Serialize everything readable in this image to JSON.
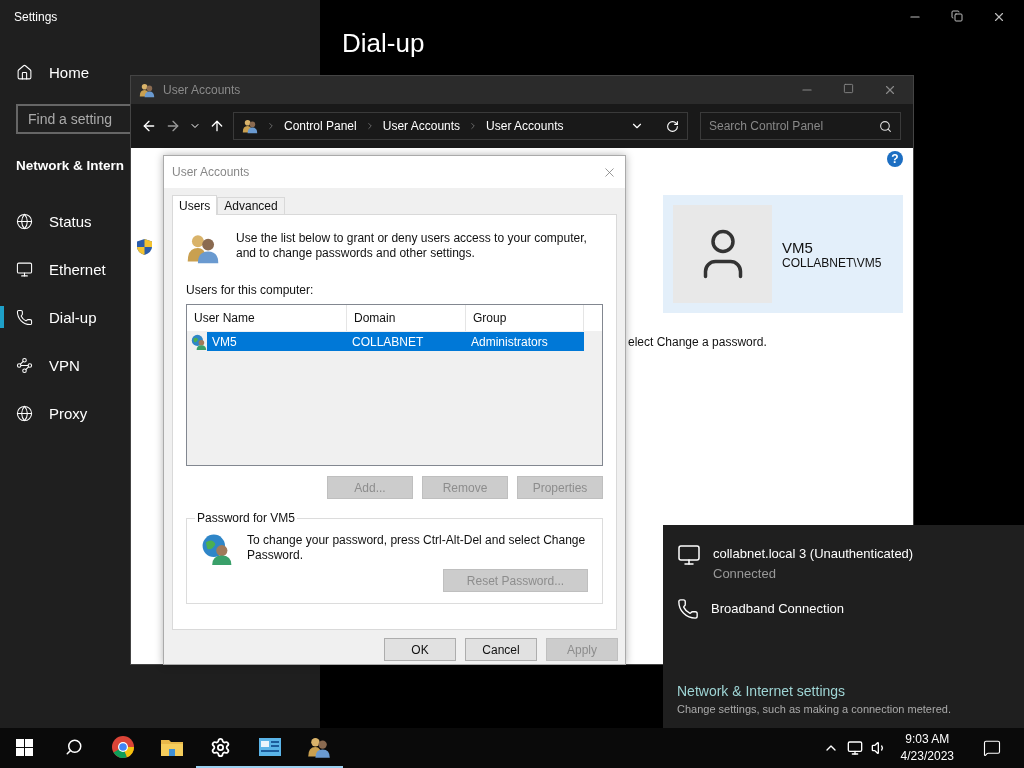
{
  "settings": {
    "title": "Settings",
    "page_title": "Dial-up",
    "home": "Home",
    "search": {
      "placeholder": "Find a setting"
    },
    "section": "Network & Intern",
    "nav": [
      {
        "label": "Status",
        "kind": "status",
        "selected": false
      },
      {
        "label": "Ethernet",
        "kind": "ethernet",
        "selected": false
      },
      {
        "label": "Dial-up",
        "kind": "dialup",
        "selected": true
      },
      {
        "label": "VPN",
        "kind": "vpn",
        "selected": false
      },
      {
        "label": "Proxy",
        "kind": "proxy",
        "selected": false
      }
    ]
  },
  "control_panel": {
    "title": "User Accounts",
    "help": "?",
    "breadcrumb": [
      "Control Panel",
      "User Accounts",
      "User Accounts"
    ],
    "search": {
      "placeholder": "Search Control Panel"
    },
    "user": {
      "name": "VM5",
      "account": "COLLABNET\\VM5"
    },
    "instruction": "elect Change a password."
  },
  "dialog": {
    "title": "User Accounts",
    "tabs": [
      {
        "label": "Users",
        "selected": true
      },
      {
        "label": "Advanced",
        "selected": false
      }
    ],
    "intro": "Use the list below to grant or deny users access to your computer, and to change passwords and other settings.",
    "list_label": "Users for this computer:",
    "columns": [
      "User Name",
      "Domain",
      "Group"
    ],
    "rows": [
      {
        "cells": [
          "VM5",
          "COLLABNET",
          "Administrators"
        ],
        "selected": true
      }
    ],
    "list_buttons": [
      {
        "label": "Add...",
        "disabled": true
      },
      {
        "label": "Remove",
        "disabled": true
      },
      {
        "label": "Properties",
        "disabled": true
      }
    ],
    "password_group": {
      "title": "Password for VM5",
      "text": "To change your password, press Ctrl-Alt-Del and select Change Password.",
      "button": {
        "label": "Reset Password...",
        "disabled": true
      }
    },
    "buttons": [
      {
        "label": "OK",
        "disabled": false
      },
      {
        "label": "Cancel",
        "disabled": false
      },
      {
        "label": "Apply",
        "disabled": true
      }
    ]
  },
  "network_flyout": {
    "connections": [
      {
        "name": "collabnet.local 3 (Unauthenticated)",
        "status": "Connected",
        "kind": "ethernet"
      },
      {
        "name": "Broadband Connection",
        "kind": "dialup"
      }
    ],
    "settings_link": "Network & Internet settings",
    "settings_hint": "Change settings, such as making a connection metered."
  },
  "taskbar": {
    "apps": [
      {
        "kind": "browser",
        "running": false
      },
      {
        "kind": "folder",
        "running": false
      },
      {
        "kind": "settings",
        "running": true
      },
      {
        "kind": "control-panel",
        "running": true
      },
      {
        "kind": "users",
        "running": true
      }
    ],
    "time": "9:03 AM",
    "date": "4/23/2023"
  }
}
